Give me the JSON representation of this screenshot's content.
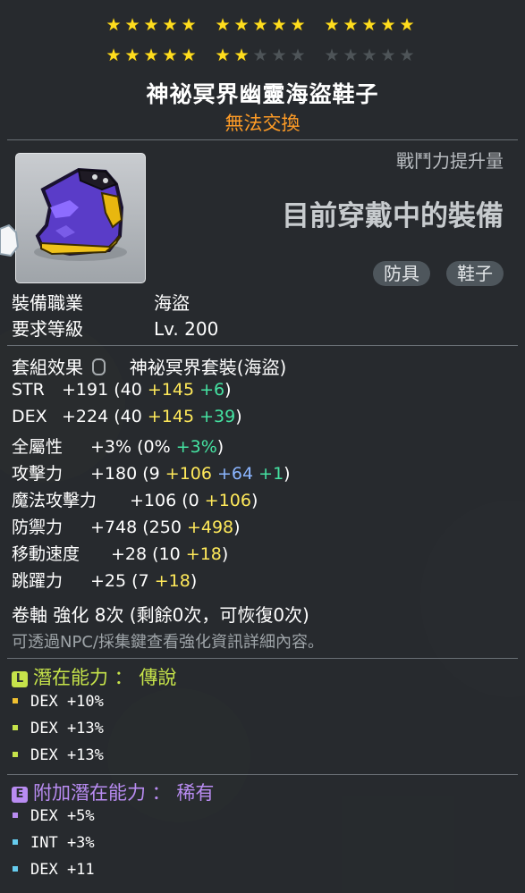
{
  "stars": {
    "row1": [
      "on",
      "on",
      "on",
      "on",
      "on",
      "on",
      "on",
      "on",
      "on",
      "on",
      "on",
      "on",
      "on",
      "on",
      "on"
    ],
    "row2": [
      "on",
      "on",
      "on",
      "on",
      "on",
      "on",
      "on",
      "off",
      "off",
      "off",
      "off",
      "off",
      "off",
      "off",
      "off"
    ]
  },
  "item": {
    "name": "神祕冥界幽靈海盜鞋子",
    "trade_status": "無法交換",
    "power_label": "戰鬥力提升量",
    "equipped_label": "目前穿戴中的裝備",
    "tags": [
      "防具",
      "鞋子"
    ],
    "image": "purple-shoes-icon"
  },
  "requirements": {
    "job_label": "裝備職業",
    "job_value": "海盜",
    "level_label": "要求等級",
    "level_value": "Lv. 200"
  },
  "set": {
    "label": "套組效果",
    "value": "神祕冥界套裝(海盜)"
  },
  "stats": [
    {
      "name": "STR",
      "total": "+191",
      "base": "(40 ",
      "bonus1": "+145",
      "bonus2": " +6",
      "bonus3": "",
      "close": ")"
    },
    {
      "name": "DEX",
      "total": "+224",
      "base": "(40 ",
      "bonus1": "+145",
      "bonus2": " +39",
      "bonus3": "",
      "close": ")"
    },
    {
      "name": "全屬性",
      "total": "+3%",
      "base": "(0% ",
      "bonus1": "",
      "bonus2": "+3%",
      "bonus3": "",
      "close": ")"
    },
    {
      "name": "攻擊力",
      "total": "+180",
      "base": "(9 ",
      "bonus1": "+106",
      "bonus2": " +64",
      "bonus3": " +1",
      "close": ")"
    },
    {
      "name": "魔法攻擊力",
      "total": "+106",
      "base": "(0 ",
      "bonus1": "+106",
      "bonus2": "",
      "bonus3": "",
      "close": ")"
    },
    {
      "name": "防禦力",
      "total": "+748",
      "base": "(250 ",
      "bonus1": "+498",
      "bonus2": "",
      "bonus3": "",
      "close": ")"
    },
    {
      "name": "移動速度",
      "total": "+28",
      "base": "(10 ",
      "bonus1": "+18",
      "bonus2": "",
      "bonus3": "",
      "close": ")"
    },
    {
      "name": "跳躍力",
      "total": "+25",
      "base": "(7 ",
      "bonus1": "+18",
      "bonus2": "",
      "bonus3": "",
      "close": ")"
    }
  ],
  "scroll": "卷軸 強化 8次 (剩餘0次，可恢復0次)",
  "note": "可透過NPC/採集鍵查看強化資訊詳細內容。",
  "potential": {
    "badge": "L",
    "label": "潛在能力 ：",
    "grade": "傳說",
    "color": "#c6e34a",
    "lines": [
      "DEX +10%",
      "DEX +13%",
      "DEX +13%"
    ]
  },
  "additional_potential": {
    "badge": "E",
    "label": "附加潛在能力 ：",
    "grade": "稀有",
    "color": "#b98cf2",
    "lines": [
      "DEX +5%",
      "INT +3%",
      "DEX +11"
    ]
  },
  "colors": {
    "title": "#ffffff",
    "trade": "#ff9c26",
    "bonus_yellow": "#ffe95a",
    "bonus_green": "#45e3a2",
    "bonus_blue": "#8bb5ff",
    "star_on": "#ffdd1e"
  }
}
